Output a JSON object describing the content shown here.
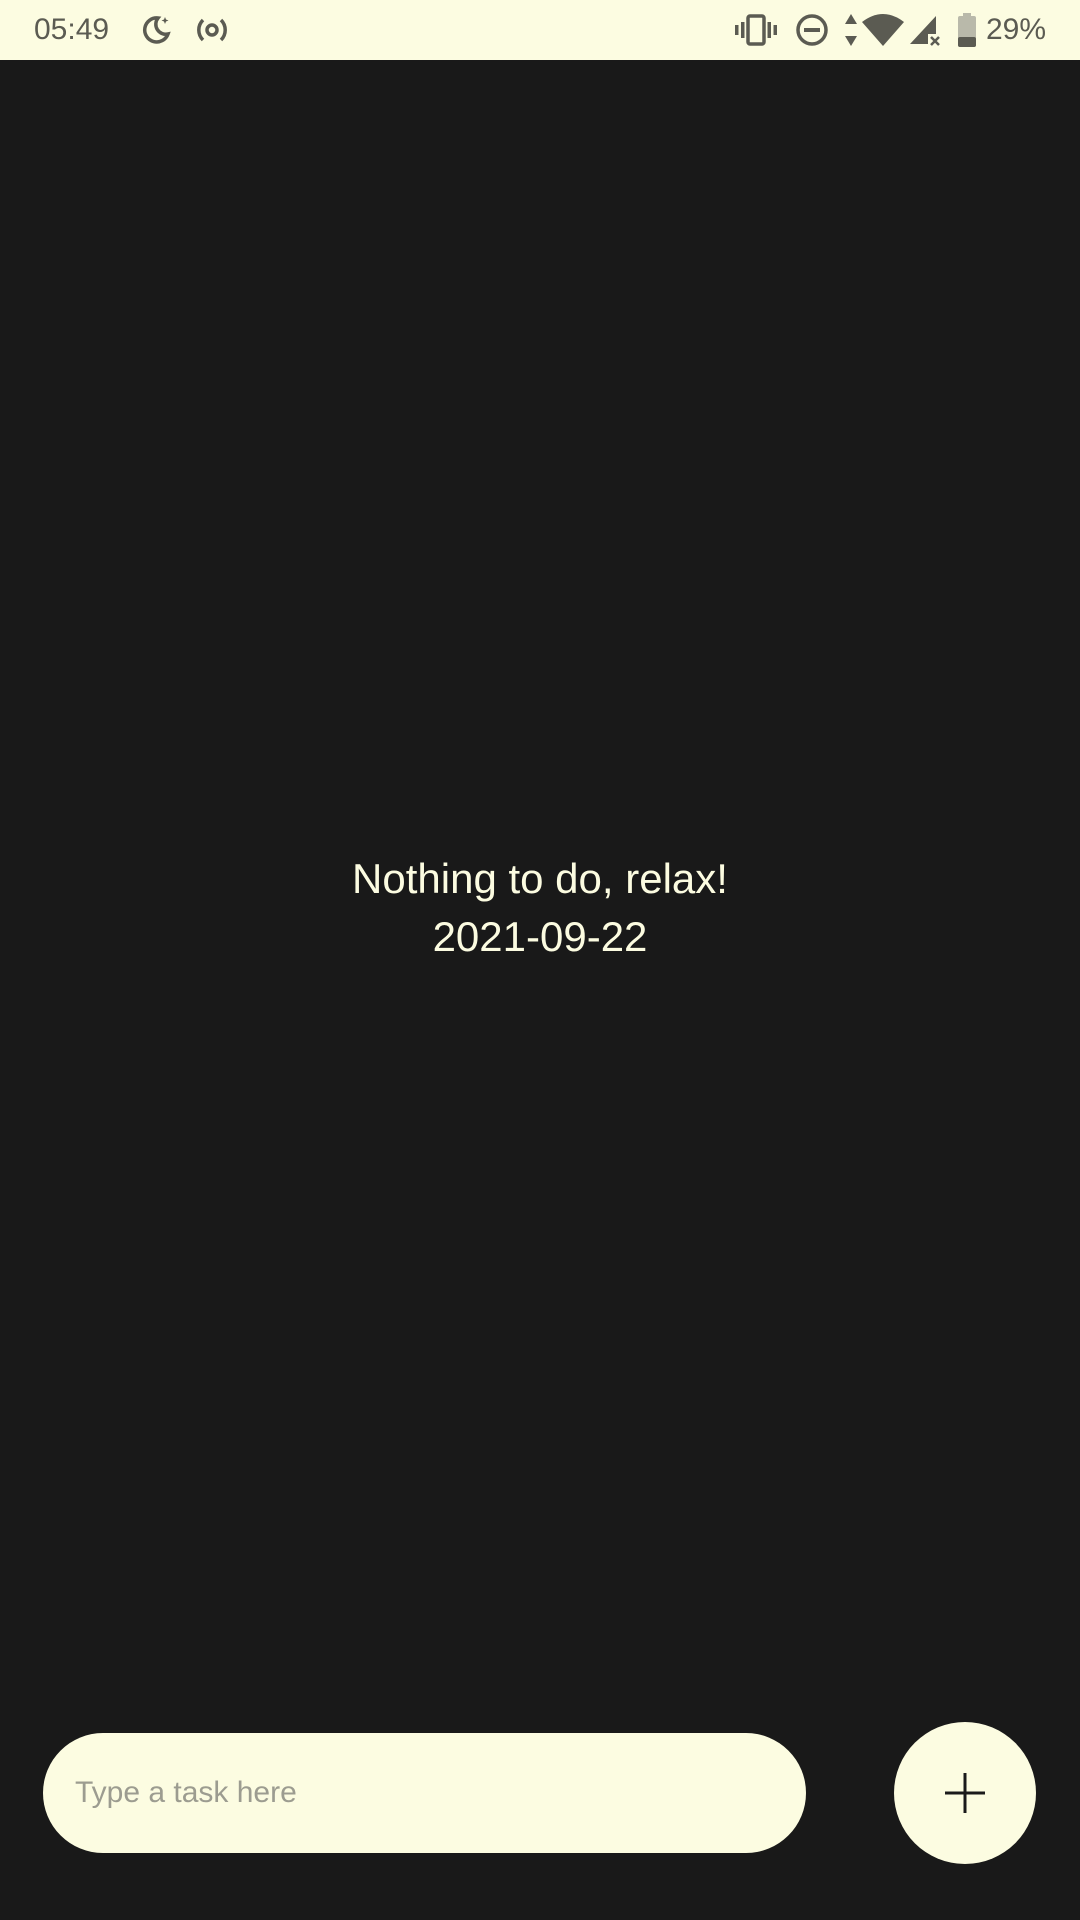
{
  "status_bar": {
    "time": "05:49",
    "battery_percent": "29%",
    "icons": [
      "night-mode-icon",
      "hotspot-icon",
      "vibrate-icon",
      "do-not-disturb-icon",
      "data-arrows-icon",
      "wifi-icon",
      "cell-signal-icon",
      "battery-icon"
    ],
    "background_color": "#fcfce1",
    "icon_color": "#5b5b52"
  },
  "main": {
    "empty_message": "Nothing to do, relax!",
    "date": "2021-09-22",
    "background_color": "#191919",
    "text_color": "#fcfce1"
  },
  "composer": {
    "input_placeholder": "Type a task here",
    "input_value": "",
    "add_button_icon": "plus-icon",
    "accent_color": "#fcfce1"
  }
}
